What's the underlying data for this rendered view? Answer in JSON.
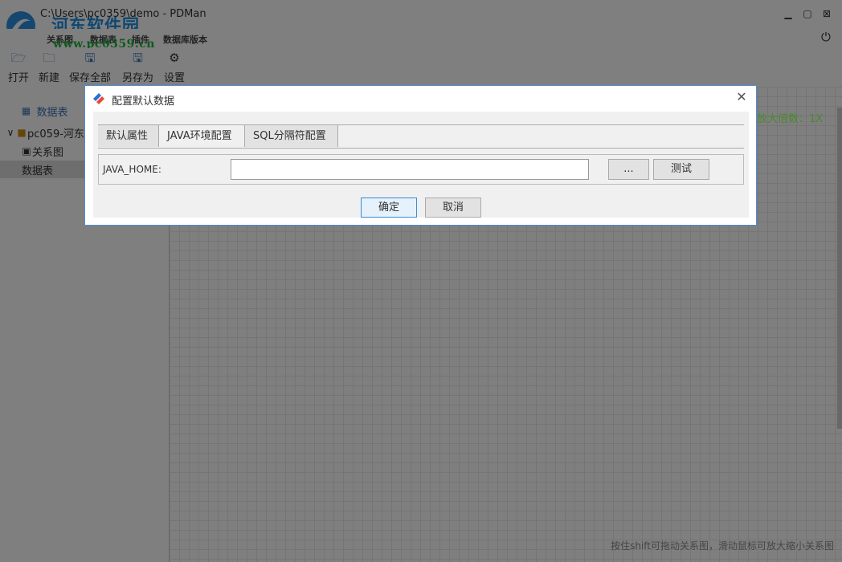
{
  "window": {
    "title": "C:\\Users\\pc0359\\demo - PDMan"
  },
  "watermark": {
    "text": "河东软件园",
    "url": "www.pc0359.cn"
  },
  "menu": {
    "items": [
      "关系图",
      "数据表",
      "插件",
      "数据库版本"
    ]
  },
  "toolbar": {
    "open": "打开",
    "new": "新建",
    "save_all": "保存全部",
    "save_as": "另存为",
    "settings": "设置"
  },
  "left_panel": {
    "tab_label": "数据表",
    "tree": {
      "project": "pc059-河东",
      "relation": "关系图",
      "tables": "数据表"
    }
  },
  "canvas": {
    "scale_label": "放大倍数：1X",
    "hint": "按住shift可拖动关系图，滑动鼠标可放大缩小关系图"
  },
  "dialog": {
    "title": "配置默认数据",
    "tabs": [
      "默认属性",
      "JAVA环境配置",
      "SQL分隔符配置"
    ],
    "active_tab": 1,
    "java_home_label": "JAVA_HOME:",
    "java_home_value": "",
    "browse_label": "...",
    "test_label": "测试",
    "ok_label": "确定",
    "cancel_label": "取消"
  },
  "colors": {
    "accent": "#3b70b5",
    "dialog_border": "#4a8fd6",
    "scale_text": "#4a8a2a"
  }
}
